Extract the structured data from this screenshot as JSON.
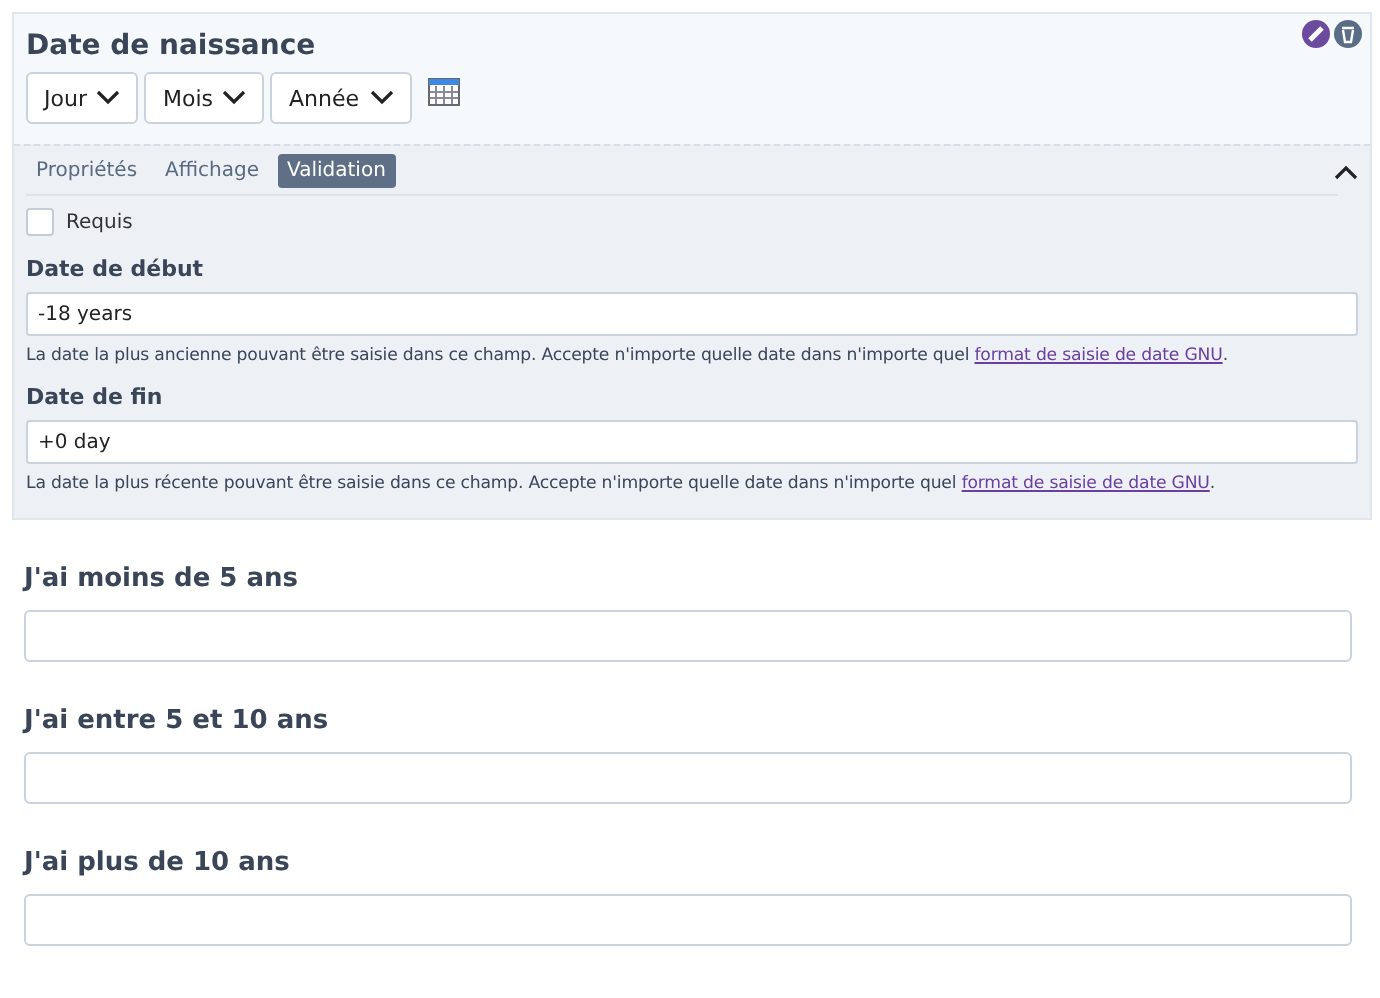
{
  "field": {
    "title": "Date de naissance",
    "selects": [
      "Jour",
      "Mois",
      "Année"
    ]
  },
  "settings": {
    "tabs": [
      {
        "label": "Propriétés",
        "selected": false
      },
      {
        "label": "Affichage",
        "selected": false
      },
      {
        "label": "Validation",
        "selected": true
      }
    ],
    "expanded": true,
    "required": {
      "label": "Requis",
      "checked": false
    },
    "inputs": [
      {
        "label": "Date de début",
        "value": "-18 years",
        "help": "La date la plus ancienne pouvant être saisie dans ce champ. Accepte n'importe quelle date dans n'importe quel",
        "link": "format de saisie de date GNU",
        "help_end": "."
      },
      {
        "label": "Date de fin",
        "value": "+0 day",
        "help": "La date la plus récente pouvant être saisie dans ce champ. Accepte n'importe quelle date dans n'importe quel",
        "link": "format de saisie de date GNU",
        "help_end": "."
      }
    ]
  },
  "questions": [
    {
      "label": "J'ai moins de 5 ans"
    },
    {
      "label": "J'ai entre 5 et 10 ans"
    },
    {
      "label": "J'ai plus de 10 ans"
    }
  ]
}
